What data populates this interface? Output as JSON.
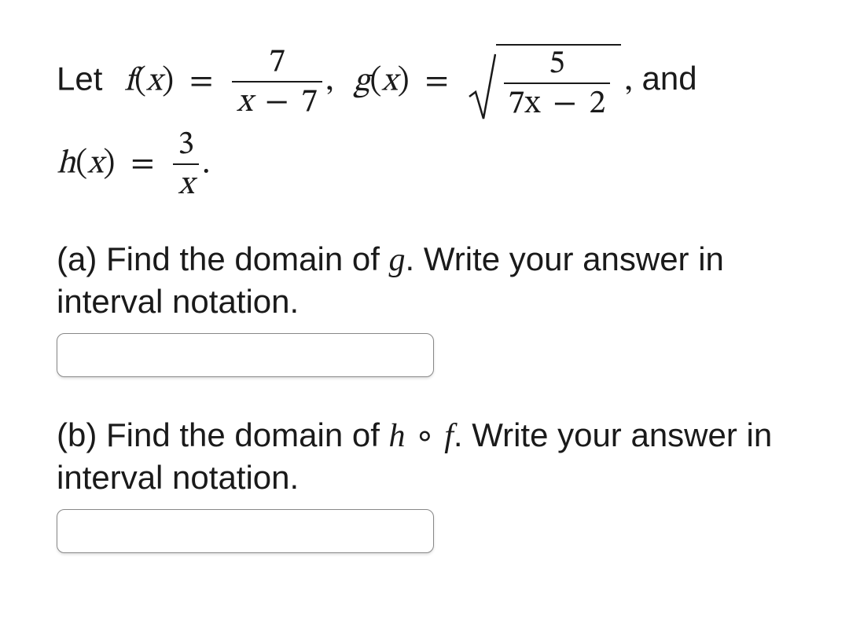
{
  "functions": {
    "let_word": "Let",
    "f_name": "f",
    "g_name": "g",
    "h_name": "h",
    "arg_open": "(",
    "arg_close": ")",
    "var": "x",
    "eq": "=",
    "comma": ",",
    "and_word": "and",
    "period": ".",
    "f_num": "7",
    "f_den_left": "x",
    "f_den_op": "−",
    "f_den_right": "7",
    "g_num": "5",
    "g_den_left": "7x",
    "g_den_op": "−",
    "g_den_right": "2",
    "h_num": "3",
    "h_den": "x"
  },
  "parts": {
    "a": {
      "label": "(a) Find the domain of ",
      "fn": "g",
      "rest": ". Write your answer in interval notation.",
      "input_value": ""
    },
    "b": {
      "label": "(b) Find the domain of ",
      "fn_left": "h",
      "compose": "∘",
      "fn_right": "f",
      "rest": ". Write your answer in interval notation.",
      "input_value": ""
    }
  }
}
